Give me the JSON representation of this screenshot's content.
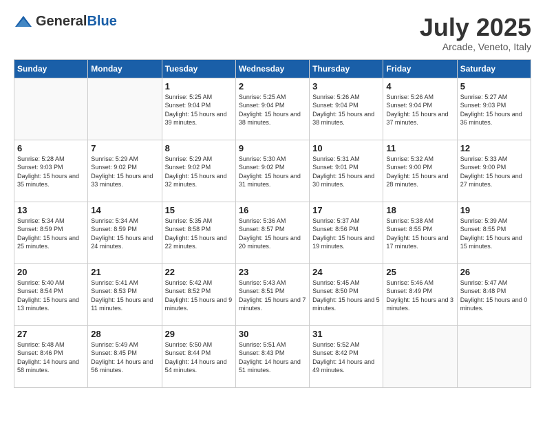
{
  "header": {
    "logo_general": "General",
    "logo_blue": "Blue",
    "month": "July 2025",
    "location": "Arcade, Veneto, Italy"
  },
  "weekdays": [
    "Sunday",
    "Monday",
    "Tuesday",
    "Wednesday",
    "Thursday",
    "Friday",
    "Saturday"
  ],
  "weeks": [
    [
      {
        "day": "",
        "info": ""
      },
      {
        "day": "",
        "info": ""
      },
      {
        "day": "1",
        "info": "Sunrise: 5:25 AM\nSunset: 9:04 PM\nDaylight: 15 hours and 39 minutes."
      },
      {
        "day": "2",
        "info": "Sunrise: 5:25 AM\nSunset: 9:04 PM\nDaylight: 15 hours and 38 minutes."
      },
      {
        "day": "3",
        "info": "Sunrise: 5:26 AM\nSunset: 9:04 PM\nDaylight: 15 hours and 38 minutes."
      },
      {
        "day": "4",
        "info": "Sunrise: 5:26 AM\nSunset: 9:04 PM\nDaylight: 15 hours and 37 minutes."
      },
      {
        "day": "5",
        "info": "Sunrise: 5:27 AM\nSunset: 9:03 PM\nDaylight: 15 hours and 36 minutes."
      }
    ],
    [
      {
        "day": "6",
        "info": "Sunrise: 5:28 AM\nSunset: 9:03 PM\nDaylight: 15 hours and 35 minutes."
      },
      {
        "day": "7",
        "info": "Sunrise: 5:29 AM\nSunset: 9:02 PM\nDaylight: 15 hours and 33 minutes."
      },
      {
        "day": "8",
        "info": "Sunrise: 5:29 AM\nSunset: 9:02 PM\nDaylight: 15 hours and 32 minutes."
      },
      {
        "day": "9",
        "info": "Sunrise: 5:30 AM\nSunset: 9:02 PM\nDaylight: 15 hours and 31 minutes."
      },
      {
        "day": "10",
        "info": "Sunrise: 5:31 AM\nSunset: 9:01 PM\nDaylight: 15 hours and 30 minutes."
      },
      {
        "day": "11",
        "info": "Sunrise: 5:32 AM\nSunset: 9:00 PM\nDaylight: 15 hours and 28 minutes."
      },
      {
        "day": "12",
        "info": "Sunrise: 5:33 AM\nSunset: 9:00 PM\nDaylight: 15 hours and 27 minutes."
      }
    ],
    [
      {
        "day": "13",
        "info": "Sunrise: 5:34 AM\nSunset: 8:59 PM\nDaylight: 15 hours and 25 minutes."
      },
      {
        "day": "14",
        "info": "Sunrise: 5:34 AM\nSunset: 8:59 PM\nDaylight: 15 hours and 24 minutes."
      },
      {
        "day": "15",
        "info": "Sunrise: 5:35 AM\nSunset: 8:58 PM\nDaylight: 15 hours and 22 minutes."
      },
      {
        "day": "16",
        "info": "Sunrise: 5:36 AM\nSunset: 8:57 PM\nDaylight: 15 hours and 20 minutes."
      },
      {
        "day": "17",
        "info": "Sunrise: 5:37 AM\nSunset: 8:56 PM\nDaylight: 15 hours and 19 minutes."
      },
      {
        "day": "18",
        "info": "Sunrise: 5:38 AM\nSunset: 8:55 PM\nDaylight: 15 hours and 17 minutes."
      },
      {
        "day": "19",
        "info": "Sunrise: 5:39 AM\nSunset: 8:55 PM\nDaylight: 15 hours and 15 minutes."
      }
    ],
    [
      {
        "day": "20",
        "info": "Sunrise: 5:40 AM\nSunset: 8:54 PM\nDaylight: 15 hours and 13 minutes."
      },
      {
        "day": "21",
        "info": "Sunrise: 5:41 AM\nSunset: 8:53 PM\nDaylight: 15 hours and 11 minutes."
      },
      {
        "day": "22",
        "info": "Sunrise: 5:42 AM\nSunset: 8:52 PM\nDaylight: 15 hours and 9 minutes."
      },
      {
        "day": "23",
        "info": "Sunrise: 5:43 AM\nSunset: 8:51 PM\nDaylight: 15 hours and 7 minutes."
      },
      {
        "day": "24",
        "info": "Sunrise: 5:45 AM\nSunset: 8:50 PM\nDaylight: 15 hours and 5 minutes."
      },
      {
        "day": "25",
        "info": "Sunrise: 5:46 AM\nSunset: 8:49 PM\nDaylight: 15 hours and 3 minutes."
      },
      {
        "day": "26",
        "info": "Sunrise: 5:47 AM\nSunset: 8:48 PM\nDaylight: 15 hours and 0 minutes."
      }
    ],
    [
      {
        "day": "27",
        "info": "Sunrise: 5:48 AM\nSunset: 8:46 PM\nDaylight: 14 hours and 58 minutes."
      },
      {
        "day": "28",
        "info": "Sunrise: 5:49 AM\nSunset: 8:45 PM\nDaylight: 14 hours and 56 minutes."
      },
      {
        "day": "29",
        "info": "Sunrise: 5:50 AM\nSunset: 8:44 PM\nDaylight: 14 hours and 54 minutes."
      },
      {
        "day": "30",
        "info": "Sunrise: 5:51 AM\nSunset: 8:43 PM\nDaylight: 14 hours and 51 minutes."
      },
      {
        "day": "31",
        "info": "Sunrise: 5:52 AM\nSunset: 8:42 PM\nDaylight: 14 hours and 49 minutes."
      },
      {
        "day": "",
        "info": ""
      },
      {
        "day": "",
        "info": ""
      }
    ]
  ]
}
